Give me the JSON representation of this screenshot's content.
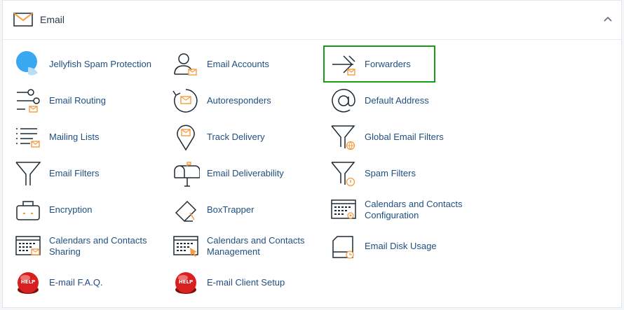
{
  "section": {
    "title": "Email",
    "collapse_icon": "chevron-up-icon"
  },
  "colors": {
    "accent": "#f39c40",
    "link": "#1f4f82",
    "highlight": "#179c18",
    "icon_stroke": "#1f2933"
  },
  "items": [
    {
      "label": "Jellyfish Spam Protection",
      "icon": "jellyfish-icon"
    },
    {
      "label": "Email Accounts",
      "icon": "email-accounts-icon"
    },
    {
      "label": "Forwarders",
      "icon": "forwarders-icon"
    },
    {
      "label": "Email Routing",
      "icon": "email-routing-icon"
    },
    {
      "label": "Autoresponders",
      "icon": "autoresponders-icon"
    },
    {
      "label": "Default Address",
      "icon": "at-sign-icon"
    },
    {
      "label": "Mailing Lists",
      "icon": "mailing-lists-icon"
    },
    {
      "label": "Track Delivery",
      "icon": "track-delivery-icon"
    },
    {
      "label": "Global Email Filters",
      "icon": "global-filter-icon"
    },
    {
      "label": "Email Filters",
      "icon": "filter-icon"
    },
    {
      "label": "Email Deliverability",
      "icon": "mailbox-icon"
    },
    {
      "label": "Spam Filters",
      "icon": "spam-filter-icon"
    },
    {
      "label": "Encryption",
      "icon": "encryption-icon"
    },
    {
      "label": "BoxTrapper",
      "icon": "boxtrapper-icon"
    },
    {
      "label": "Calendars and Contacts Configuration",
      "icon": "calendar-config-icon"
    },
    {
      "label": "Calendars and Contacts Sharing",
      "icon": "calendar-sharing-icon"
    },
    {
      "label": "Calendars and Contacts Management",
      "icon": "calendar-management-icon"
    },
    {
      "label": "Email Disk Usage",
      "icon": "disk-usage-icon"
    },
    {
      "label": "E-mail F.A.Q.",
      "icon": "help-button-icon"
    },
    {
      "label": "E-mail Client Setup",
      "icon": "help-button-icon"
    }
  ]
}
